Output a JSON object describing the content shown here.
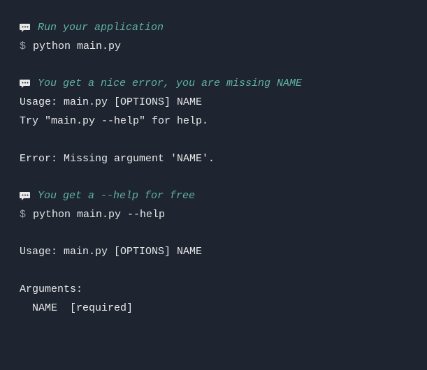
{
  "section1": {
    "comment": "Run your application",
    "prompt": "$",
    "command": "python main.py"
  },
  "section2": {
    "comment": "You get a nice error, you are missing NAME",
    "usage": "Usage: main.py [OPTIONS] NAME",
    "try": "Try \"main.py --help\" for help.",
    "error": "Error: Missing argument 'NAME'."
  },
  "section3": {
    "comment": "You get a --help for free",
    "prompt": "$",
    "command": "python main.py --help"
  },
  "section4": {
    "usage": "Usage: main.py [OPTIONS] NAME",
    "args_header": "Arguments:",
    "args_line": "NAME  [required]"
  }
}
